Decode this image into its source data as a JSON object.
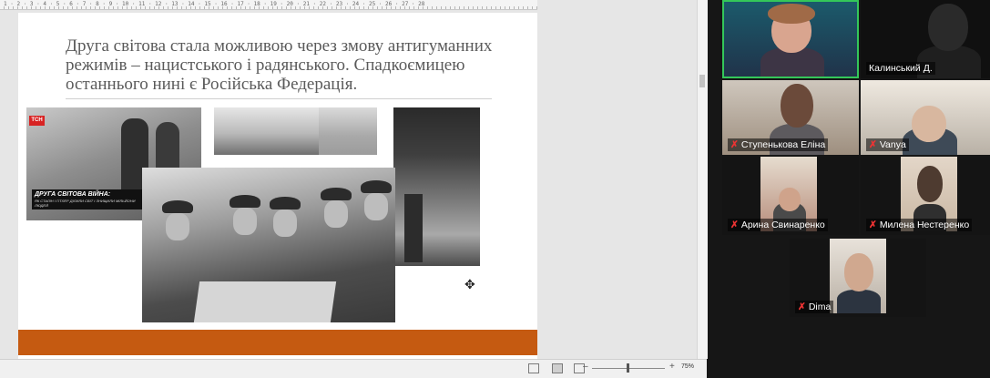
{
  "ruler": {
    "ticks": "1 · 2 · 3 · 4 · 5 · 6 · 7 · 8 · 9 · 10 · 11 · 12 · 13 · 14 · 15 · 16 · 17 · 18 · 19 · 20 · 21 · 22 · 23 · 24 · 25 · 26 · 27 · 28"
  },
  "slide": {
    "title": "Друга світова стала можливою через змову антигуманних режимів – нацистського і радянського. Спадкоємицею останнього нині є Російська Федерація.",
    "photo_logo": "ТСН",
    "photo_caption": "ДРУГА СВІТОВА ВІЙНА:",
    "photo_caption_sub": "ЯК СТАЛІН І ГІТЛЕР ДІЛИЛИ СВІТ І ЗНИЩИЛИ МІЛЬЙОНИ ЛЮДЕЙ",
    "accent_color": "#c55a11"
  },
  "statusbar": {
    "zoom_level": "75%",
    "zoom_minus": "–",
    "zoom_plus": "+",
    "zoom_fraction": 0.47
  },
  "participants": [
    {
      "name": ""
    },
    {
      "name": "Калинський Д."
    },
    {
      "name": "Ступенькова Еліна",
      "muted": true
    },
    {
      "name": "Vanya",
      "muted": true
    },
    {
      "name": "Арина Свинаренко",
      "muted": true
    },
    {
      "name": "Милена Нестеренко",
      "muted": true
    },
    {
      "name": "Dima",
      "muted": true
    }
  ],
  "icons": {
    "mic_off": "✗",
    "move_cursor": "✥"
  }
}
